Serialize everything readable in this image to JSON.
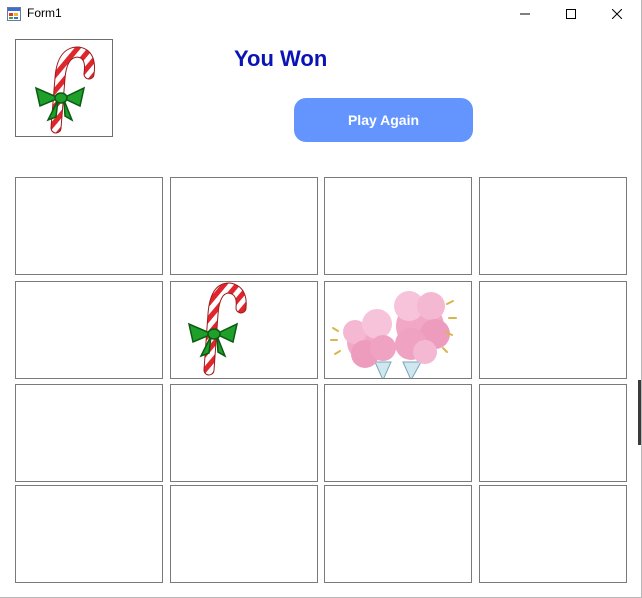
{
  "window": {
    "title": "Form1",
    "icons": {
      "app": "form-app-icon",
      "minimize": "minimize-icon",
      "maximize": "maximize-icon",
      "close": "close-icon"
    }
  },
  "header": {
    "status_text": "You Won",
    "play_again_label": "Play Again",
    "preview_image": "candy-cane-icon",
    "colors": {
      "status_text": "#0a14b4",
      "button_bg": "#6495ff",
      "button_text": "#ffffff"
    }
  },
  "board": {
    "rows": 4,
    "cols": 4,
    "cells": [
      [
        {
          "image": ""
        },
        {
          "image": ""
        },
        {
          "image": ""
        },
        {
          "image": ""
        }
      ],
      [
        {
          "image": ""
        },
        {
          "image": "candy-cane-icon"
        },
        {
          "image": "cotton-candy-icon"
        },
        {
          "image": ""
        }
      ],
      [
        {
          "image": ""
        },
        {
          "image": ""
        },
        {
          "image": ""
        },
        {
          "image": ""
        }
      ],
      [
        {
          "image": ""
        },
        {
          "image": ""
        },
        {
          "image": ""
        },
        {
          "image": ""
        }
      ]
    ]
  }
}
